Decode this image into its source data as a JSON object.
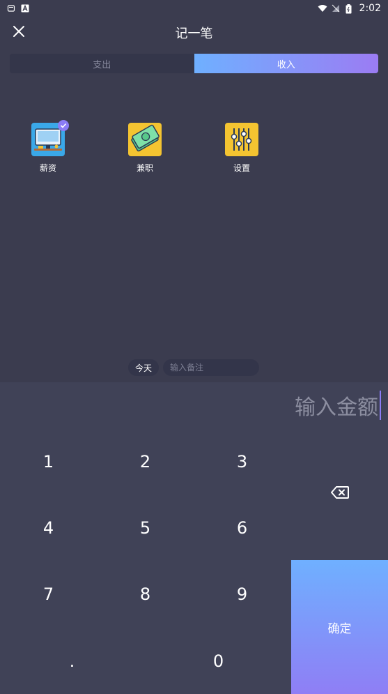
{
  "status_bar": {
    "time": "2:02"
  },
  "header": {
    "title": "记一笔"
  },
  "tabs": [
    {
      "label": "支出",
      "active": false
    },
    {
      "label": "收入",
      "active": true
    }
  ],
  "categories": [
    {
      "label": "薪资",
      "icon": "salary-computer-icon",
      "selected": true
    },
    {
      "label": "兼职",
      "icon": "part-time-money-icon",
      "selected": false
    },
    {
      "label": "设置",
      "icon": "settings-sliders-icon",
      "selected": false
    }
  ],
  "note": {
    "date_label": "今天",
    "placeholder": "输入备注"
  },
  "amount": {
    "placeholder": "输入金额"
  },
  "keypad": {
    "keys": [
      "1",
      "2",
      "3",
      "4",
      "5",
      "6",
      "7",
      "8",
      "9",
      ".",
      "0"
    ],
    "confirm_label": "确定"
  },
  "colors": {
    "background": "#3b3c4f",
    "keypad_background": "#404257",
    "accent_start": "#6fb0ff",
    "accent_end": "#9b7cf3"
  }
}
